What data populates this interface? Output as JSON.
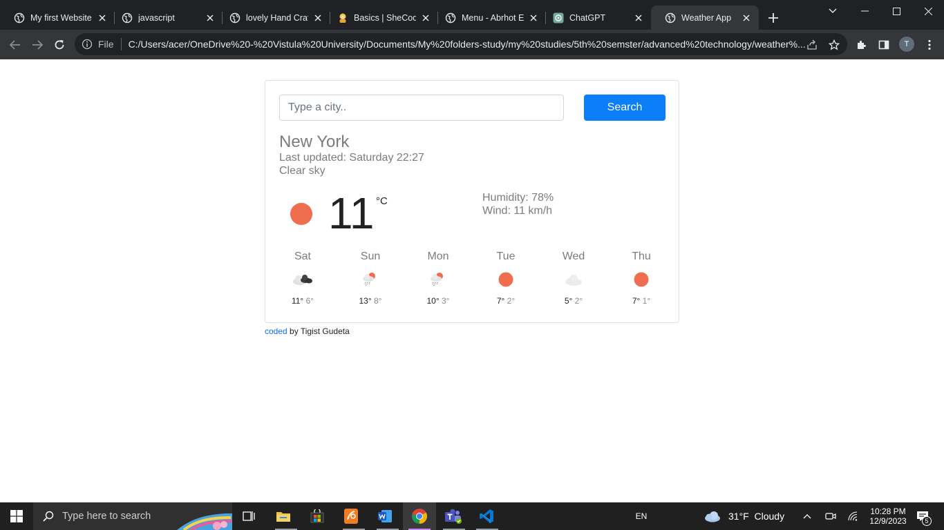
{
  "browser": {
    "tabs": [
      {
        "title": "My first Website",
        "icon": "globe-icon"
      },
      {
        "title": "javascript",
        "icon": "globe-icon"
      },
      {
        "title": "lovely Hand Craf",
        "icon": "globe-icon"
      },
      {
        "title": "Basics | SheCode",
        "icon": "shecodes-icon"
      },
      {
        "title": "Menu - Abrhot E",
        "icon": "globe-icon"
      },
      {
        "title": "ChatGPT",
        "icon": "chatgpt-icon"
      },
      {
        "title": "Weather App",
        "icon": "globe-icon",
        "active": true
      }
    ],
    "address": {
      "scheme": "File",
      "url": "C:/Users/acer/OneDrive%20-%20Vistula%20University/Documents/My%20folders-study/my%20studies/5th%20semster/advanced%20technology/weather%..."
    },
    "profile_initial": "T"
  },
  "weather": {
    "search": {
      "placeholder": "Type a city..",
      "button_label": "Search"
    },
    "city": "New York",
    "last_updated": "Last updated: Saturday 22:27",
    "description": "Clear sky",
    "temperature": "11",
    "unit": "°C",
    "humidity": "Humidity: 78%",
    "wind": "Wind: 11 km/h",
    "forecast": [
      {
        "day": "Sat",
        "icon": "broken-clouds-icon",
        "max": "11°",
        "min": "6°"
      },
      {
        "day": "Sun",
        "icon": "rain-sun-icon",
        "max": "13°",
        "min": "8°"
      },
      {
        "day": "Mon",
        "icon": "rain-sun-icon",
        "max": "10°",
        "min": "3°"
      },
      {
        "day": "Tue",
        "icon": "sun-icon",
        "max": "7°",
        "min": "2°"
      },
      {
        "day": "Wed",
        "icon": "few-clouds-icon",
        "max": "5°",
        "min": "2°"
      },
      {
        "day": "Thu",
        "icon": "sun-icon",
        "max": "7°",
        "min": "1°"
      }
    ],
    "colors": {
      "sun": "#ee6e4f",
      "button": "#0d7ef9",
      "link": "#0d6efd"
    }
  },
  "footer": {
    "link_text": "coded",
    "text": " by Tigist Gudeta"
  },
  "taskbar": {
    "search_placeholder": "Type here to search",
    "language": "EN",
    "weather": "31°F  Cloudy",
    "time": "10:28 PM",
    "date": "12/9/2023",
    "notification_count": "5"
  }
}
